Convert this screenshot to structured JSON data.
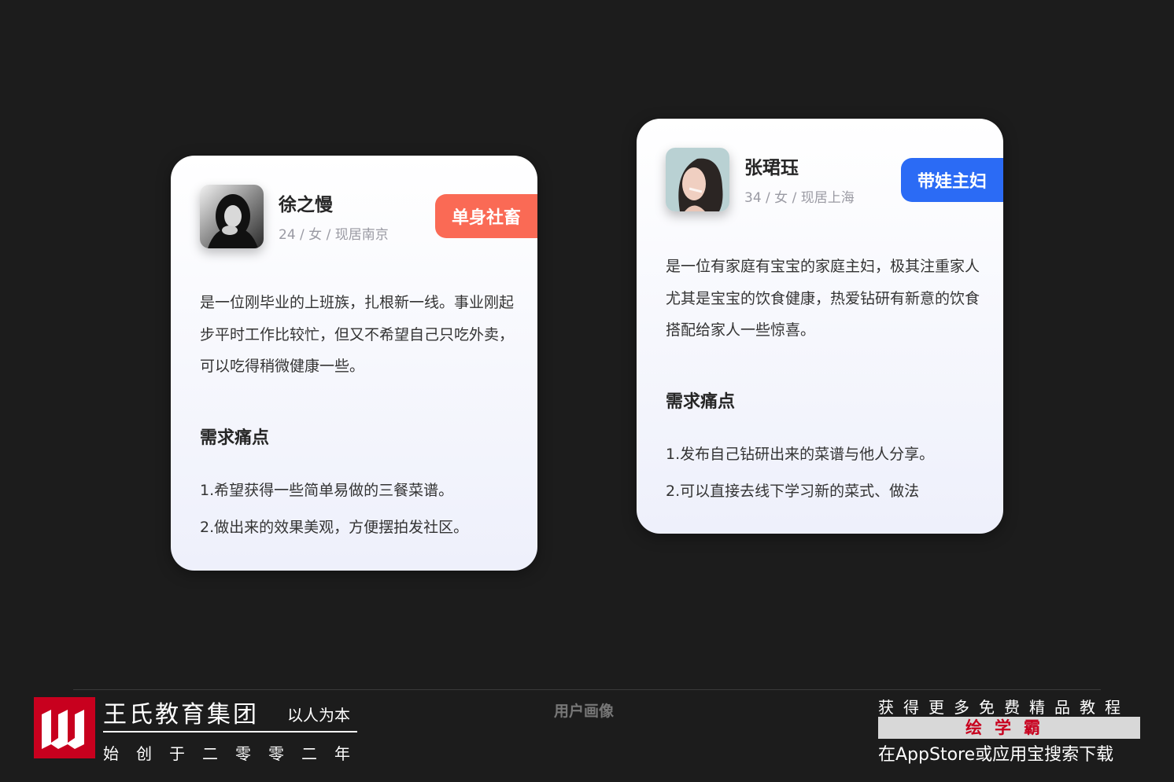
{
  "cards": [
    {
      "name": "徐之慢",
      "meta": "24 / 女 / 现居南京",
      "tag": "单身社畜",
      "tag_color": "#fa6a55",
      "desc": "是一位刚毕业的上班族，扎根新一线。事业刚起步平时工作比较忙，但又不希望自己只吃外卖，可以吃得稍微健康一些。",
      "needs_title": "需求痛点",
      "needs": [
        "1.希望获得一些简单易做的三餐菜谱。",
        "2.做出来的效果美观，方便摆拍发社区。"
      ]
    },
    {
      "name": "张珺珏",
      "meta": "34 / 女 / 现居上海",
      "tag": "带娃主妇",
      "tag_color": "#2b6bf5",
      "desc": "是一位有家庭有宝宝的家庭主妇，极其注重家人尤其是宝宝的饮食健康，热爱钻研有新意的饮食搭配给家人一些惊喜。",
      "needs_title": "需求痛点",
      "needs": [
        "1.发布自己钻研出来的菜谱与他人分享。",
        "2.可以直接去线下学习新的菜式、做法"
      ]
    }
  ],
  "footer": {
    "brand": "王氏教育集团",
    "motto": "以人为本",
    "since": "始创于二零零二年",
    "page_label": "用户画像",
    "promo_line1": "获得更多免费精品教程",
    "promo_app": "绘学霸",
    "promo_line3": "在AppStore或应用宝搜索下载"
  }
}
